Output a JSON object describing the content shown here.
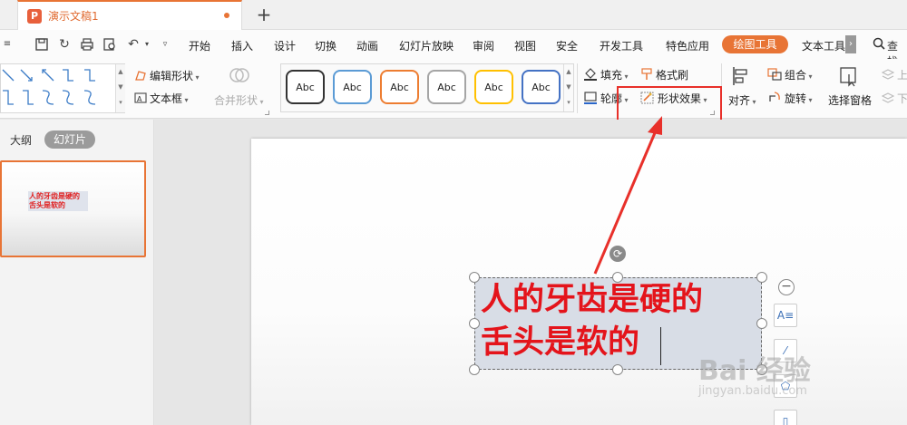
{
  "tabbar": {
    "doc_icon": "P",
    "doc_title": "演示文稿1",
    "new_tab": "+"
  },
  "menubar": {
    "items": [
      "开始",
      "插入",
      "设计",
      "切换",
      "动画",
      "幻灯片放映",
      "审阅",
      "视图",
      "安全",
      "开发工具",
      "特色应用"
    ],
    "active_tab": "绘图工具",
    "text_tool": "文本工具",
    "search_label": "查找",
    "quick_icons": [
      "save-icon",
      "redo-icon",
      "print-icon",
      "print-preview-icon",
      "undo-icon",
      "dropdown-icon"
    ]
  },
  "ribbon": {
    "edit_shape": "编辑形状",
    "text_box": "文本框",
    "merge_shape": "合并形状",
    "style_samples": [
      "Abc",
      "Abc",
      "Abc",
      "Abc",
      "Abc",
      "Abc"
    ],
    "style_border_colors": [
      "#333333",
      "#5b9bd5",
      "#ed7d31",
      "#a5a5a5",
      "#ffc000",
      "#4472c4"
    ],
    "fill": "填充",
    "format_painter": "格式刷",
    "outline": "轮廓",
    "shape_effect": "形状效果",
    "align": "对齐",
    "group": "组合",
    "rotate": "旋转",
    "selection_pane": "选择窗格",
    "up_partial": "上",
    "down_partial": "下"
  },
  "leftpanel": {
    "tab_outline": "大纲",
    "tab_slides": "幻灯片",
    "thumb_line1": "人的牙齿是硬的",
    "thumb_line2": "舌头是软的"
  },
  "slide": {
    "line1": "人的牙齿是硬的",
    "line2": "舌头是软的"
  },
  "watermark": {
    "brand": "Bai 经验",
    "url": "jingyan.baidu.com"
  },
  "colors": {
    "accent": "#e87435",
    "highlight": "#e8302a",
    "text_red": "#e4141b"
  }
}
